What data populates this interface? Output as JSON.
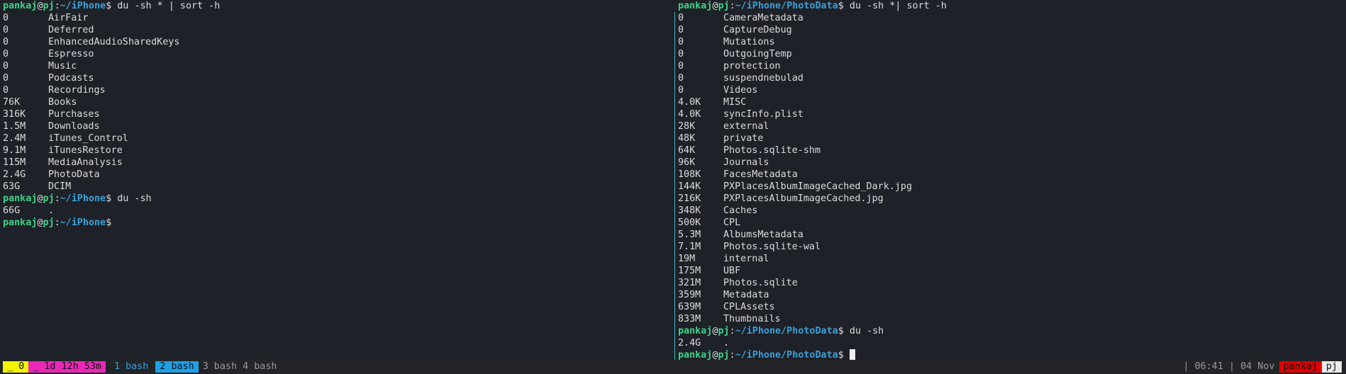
{
  "prompt": {
    "user": "pankaj",
    "at": "@",
    "host": "pj",
    "sep": ":",
    "dollar": "$"
  },
  "left": {
    "path": "~/iPhone",
    "cmd1": " du -sh * | sort -h",
    "rows": [
      {
        "size": "0",
        "name": "AirFair"
      },
      {
        "size": "0",
        "name": "Deferred"
      },
      {
        "size": "0",
        "name": "EnhancedAudioSharedKeys"
      },
      {
        "size": "0",
        "name": "Espresso"
      },
      {
        "size": "0",
        "name": "Music"
      },
      {
        "size": "0",
        "name": "Podcasts"
      },
      {
        "size": "0",
        "name": "Recordings"
      },
      {
        "size": "76K",
        "name": "Books"
      },
      {
        "size": "316K",
        "name": "Purchases"
      },
      {
        "size": "1.5M",
        "name": "Downloads"
      },
      {
        "size": "2.4M",
        "name": "iTunes_Control"
      },
      {
        "size": "9.1M",
        "name": "iTunesRestore"
      },
      {
        "size": "115M",
        "name": "MediaAnalysis"
      },
      {
        "size": "2.4G",
        "name": "PhotoData"
      },
      {
        "size": "63G",
        "name": "DCIM"
      }
    ],
    "cmd2": " du -sh",
    "total": {
      "size": "66G",
      "name": "."
    }
  },
  "right": {
    "path": "~/iPhone/PhotoData",
    "cmd1": " du -sh *| sort -h",
    "rows": [
      {
        "size": "0",
        "name": "CameraMetadata"
      },
      {
        "size": "0",
        "name": "CaptureDebug"
      },
      {
        "size": "0",
        "name": "Mutations"
      },
      {
        "size": "0",
        "name": "OutgoingTemp"
      },
      {
        "size": "0",
        "name": "protection"
      },
      {
        "size": "0",
        "name": "suspendnebulad"
      },
      {
        "size": "0",
        "name": "Videos"
      },
      {
        "size": "4.0K",
        "name": "MISC"
      },
      {
        "size": "4.0K",
        "name": "syncInfo.plist"
      },
      {
        "size": "28K",
        "name": "external"
      },
      {
        "size": "48K",
        "name": "private"
      },
      {
        "size": "64K",
        "name": "Photos.sqlite-shm"
      },
      {
        "size": "96K",
        "name": "Journals"
      },
      {
        "size": "108K",
        "name": "FacesMetadata"
      },
      {
        "size": "144K",
        "name": "PXPlacesAlbumImageCached_Dark.jpg"
      },
      {
        "size": "216K",
        "name": "PXPlacesAlbumImageCached.jpg"
      },
      {
        "size": "348K",
        "name": "Caches"
      },
      {
        "size": "500K",
        "name": "CPL"
      },
      {
        "size": "5.3M",
        "name": "AlbumsMetadata"
      },
      {
        "size": "7.1M",
        "name": "Photos.sqlite-wal"
      },
      {
        "size": "19M",
        "name": "internal"
      },
      {
        "size": "175M",
        "name": "UBF"
      },
      {
        "size": "321M",
        "name": "Photos.sqlite"
      },
      {
        "size": "359M",
        "name": "Metadata"
      },
      {
        "size": "639M",
        "name": "CPLAssets"
      },
      {
        "size": "833M",
        "name": "Thumbnails"
      }
    ],
    "cmd2": " du -sh",
    "total": {
      "size": "2.4G",
      "name": "."
    }
  },
  "status": {
    "session": "_ 0",
    "uptime": "_ 1d 12h 53m",
    "win1": "1 bash",
    "win2": "2 bash",
    "rest": "3 bash 4 bash",
    "time": "| 06:41 | 04 Nov",
    "user": "pankaj",
    "host": "pj"
  },
  "colors": {
    "bg": "#1e2127",
    "user": "#3fd28a",
    "path": "#3aa0d8",
    "divider": "#3fb6c4"
  }
}
